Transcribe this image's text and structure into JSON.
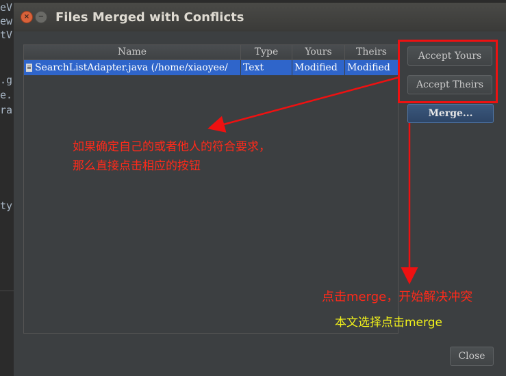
{
  "background_code": [
    "eV",
    "ew",
    "tV",
    ".g",
    "e.",
    "ra",
    "ty"
  ],
  "dialog": {
    "title": "Files Merged with Conflicts",
    "window_buttons": [
      "close-icon",
      "minimize-icon"
    ]
  },
  "table": {
    "columns": [
      "Name",
      "Type",
      "Yours",
      "Theirs"
    ],
    "rows": [
      {
        "name": "SearchListAdapter.java (/home/xiaoyee/",
        "type": "Text",
        "yours": "Modified",
        "theirs": "Modified",
        "icon": "java-file-icon"
      }
    ]
  },
  "buttons": {
    "accept_yours": "Accept Yours",
    "accept_theirs": "Accept Theirs",
    "merge": "Merge...",
    "close": "Close"
  },
  "annotations": {
    "line1": "如果确定自己的或者他人的符合要求，",
    "line2": "那么直接点击相应的按钮",
    "merge_note": "点击merge，开始解决冲突",
    "choice_note": "本文选择点击merge"
  },
  "colors": {
    "annotation_red": "#ff2a1a",
    "annotation_yellow": "#f2f21a",
    "selection": "#2f65ca"
  }
}
